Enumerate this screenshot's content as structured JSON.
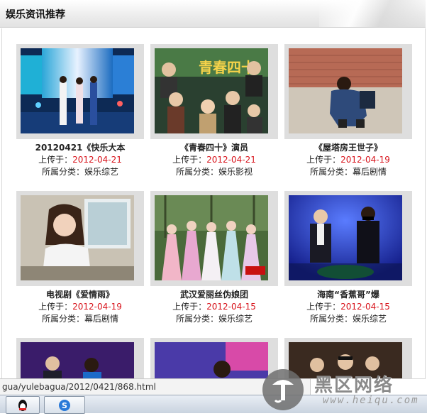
{
  "header": {
    "title": "娱乐资讯推荐"
  },
  "items": [
    {
      "title": "20120421《快乐大本",
      "uploaded_label": "上传于：",
      "date": "2012-04-21",
      "category_label": "所属分类：",
      "category": "娱乐综艺"
    },
    {
      "title": "《青春四十》演员",
      "uploaded_label": "上传于：",
      "date": "2012-04-21",
      "category_label": "所属分类：",
      "category": "娱乐影视"
    },
    {
      "title": "《屋塔房王世子》",
      "uploaded_label": "上传于：",
      "date": "2012-04-19",
      "category_label": "所属分类：",
      "category": "幕后剧情"
    },
    {
      "title": "电视剧《爱情雨》",
      "uploaded_label": "上传于：",
      "date": "2012-04-19",
      "category_label": "所属分类：",
      "category": "幕后剧情"
    },
    {
      "title": "武汉爱丽丝伪娘团",
      "uploaded_label": "上传于：",
      "date": "2012-04-15",
      "category_label": "所属分类：",
      "category": "娱乐综艺"
    },
    {
      "title": "海南“香蕉哥”爆",
      "uploaded_label": "上传于：",
      "date": "2012-04-15",
      "category_label": "所属分类：",
      "category": "娱乐综艺"
    }
  ],
  "thumb_text": {
    "poster_title": "青春四十"
  },
  "status_bar": {
    "url": "gua/yulebagua/2012/0421/868.html"
  },
  "watermark": {
    "brand": "黑区网络",
    "url": "www.heiqu.com"
  },
  "colors": {
    "date": "#d8141c",
    "thumb_border": "#dedede"
  },
  "icons": [
    "qq-icon",
    "sogou-icon",
    "heiqu-logo-icon"
  ]
}
